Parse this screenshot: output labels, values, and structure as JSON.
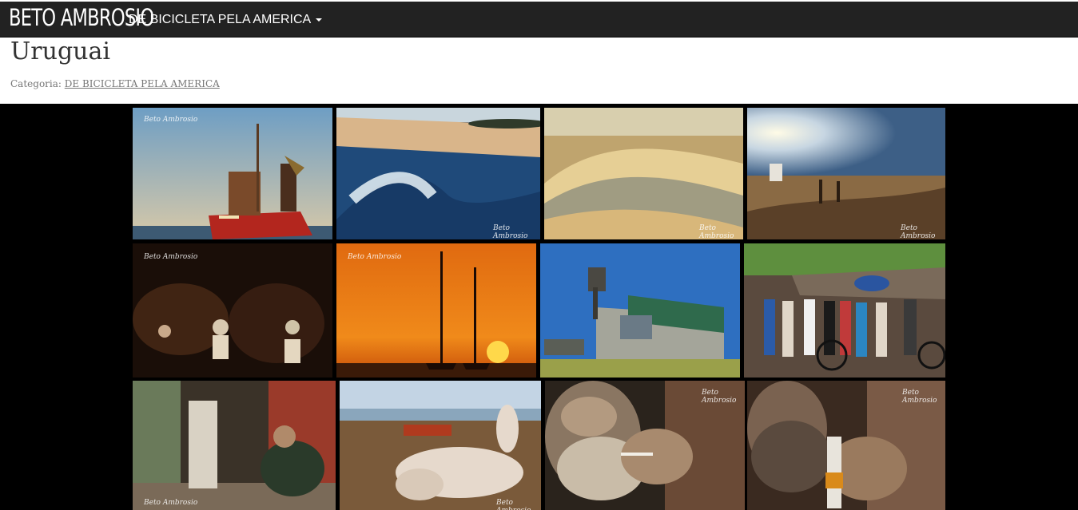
{
  "navbar": {
    "brand": "BETO AMBROSIO",
    "menu_label": "DE BICICLETA PELA AMERICA"
  },
  "page": {
    "title": "Uruguai",
    "category_prefix": "Categoria:",
    "category_link": "DE BICICLETA PELA AMERICA"
  },
  "gallery": {
    "watermark": "Beto Ambrosio",
    "photos": [
      {
        "subject": "fishing boat"
      },
      {
        "subject": "wave"
      },
      {
        "subject": "sand dunes"
      },
      {
        "subject": "beach lifeguard tower"
      },
      {
        "subject": "drummers at night"
      },
      {
        "subject": "sailboats at sunset"
      },
      {
        "subject": "hostel building"
      },
      {
        "subject": "group of cyclists"
      },
      {
        "subject": "man on chair"
      },
      {
        "subject": "dog on dock"
      },
      {
        "subject": "old man smoking"
      },
      {
        "subject": "old man with bottle"
      }
    ]
  }
}
